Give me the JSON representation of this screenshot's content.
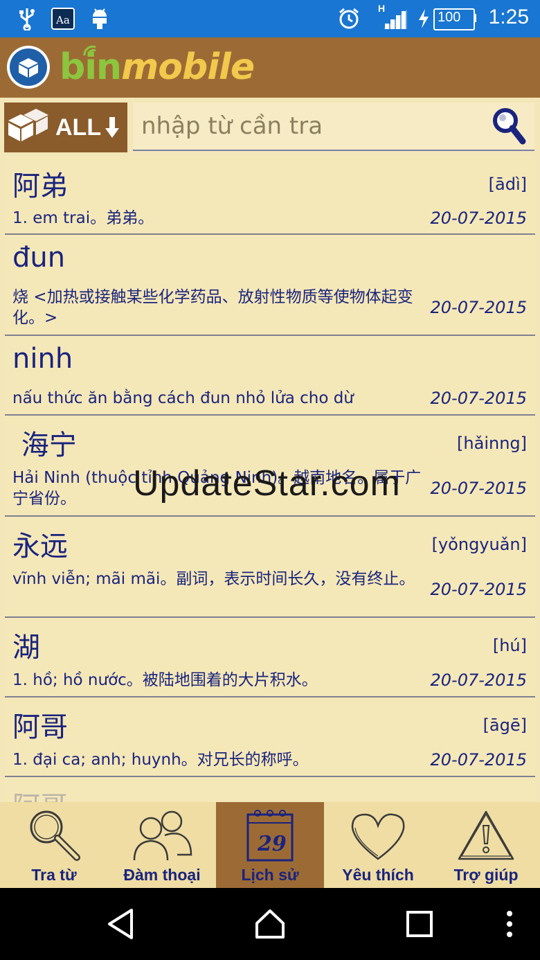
{
  "status_bar": {
    "signal_label": "H",
    "battery": "100",
    "time": "1:25"
  },
  "app": {
    "brand_bin": "bin",
    "brand_mobile": "mobile"
  },
  "search": {
    "filter_label": "ALL",
    "placeholder": "nhập từ cần tra"
  },
  "entries": [
    {
      "headword": "阿弟",
      "pinyin": "[ādì]",
      "definition": "1. em trai。弟弟。",
      "date": "20-07-2015"
    },
    {
      "headword": "đun",
      "pinyin": "",
      "definition": "烧 <加热或接触某些化学药品、放射性物质等使物体起变化。>",
      "date": "20-07-2015"
    },
    {
      "headword": "ninh",
      "pinyin": "",
      "definition": "nấu thức ăn bằng cách đun nhỏ lửa cho dừ",
      "date": "20-07-2015"
    },
    {
      "headword": " 海宁",
      "pinyin": "[hǎinng]",
      "definition": "Hải Ninh (thuộc tỉnh Quảng Ninh)。越南地名。属于广宁省份。",
      "date": "20-07-2015"
    },
    {
      "headword": "永远",
      "pinyin": "[yǒngyuǎn]",
      "definition": "vĩnh viễn; mãi mãi。副词，表示时间长久，没有终止。",
      "date": "20-07-2015"
    },
    {
      "headword": "湖",
      "pinyin": "[hú]",
      "definition": "1. hồ; hồ nước。被陆地围着的大片积水。",
      "date": "20-07-2015"
    },
    {
      "headword": "阿哥",
      "pinyin": "[āgē]",
      "definition": "1. đại ca; anh; huynh。对兄长的称呼。",
      "date": "20-07-2015"
    },
    {
      "headword": "阿哥",
      "pinyin": "",
      "definition": "",
      "date": ""
    }
  ],
  "watermark": "UpdateStar.com",
  "tabs": [
    {
      "label": "Tra từ",
      "icon": "magnifier-icon"
    },
    {
      "label": "Đàm thoại",
      "icon": "people-icon"
    },
    {
      "label": "Lịch sử",
      "icon": "calendar-icon",
      "active": true,
      "calendar_day": "29"
    },
    {
      "label": "Yêu thích",
      "icon": "heart-icon"
    },
    {
      "label": "Trợ giúp",
      "icon": "warning-icon"
    }
  ],
  "colors": {
    "status_bar": "#1976D2",
    "app_bar": "#9C6B35",
    "background": "#F3E6B8",
    "text": "#1A237E",
    "brand_green": "#8CC63F",
    "brand_yellow": "#F2C94C"
  }
}
